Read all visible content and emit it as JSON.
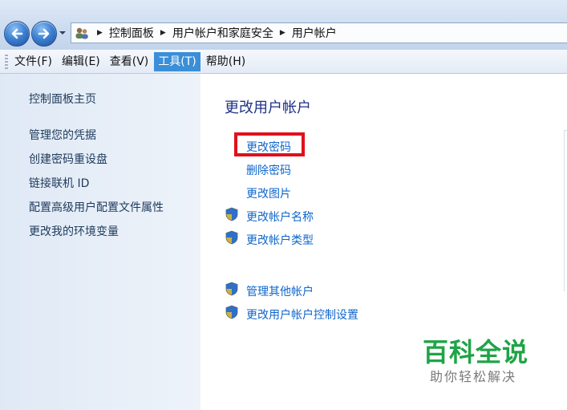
{
  "address_bar": {
    "breadcrumbs": [
      "控制面板",
      "用户帐户和家庭安全",
      "用户帐户"
    ]
  },
  "menu": {
    "items": [
      {
        "label": "文件(F)"
      },
      {
        "label": "编辑(E)"
      },
      {
        "label": "查看(V)"
      },
      {
        "label": "工具(T)",
        "active": true
      },
      {
        "label": "帮助(H)"
      }
    ]
  },
  "sidebar": {
    "home": "控制面板主页",
    "links": [
      "管理您的凭据",
      "创建密码重设盘",
      "链接联机 ID",
      "配置高级用户配置文件属性",
      "更改我的环境变量"
    ]
  },
  "main": {
    "title": "更改用户帐户",
    "tasks": [
      {
        "label": "更改密码",
        "shield": false,
        "highlighted": true
      },
      {
        "label": "删除密码",
        "shield": false
      },
      {
        "label": "更改图片",
        "shield": false
      },
      {
        "label": "更改帐户名称",
        "shield": true
      },
      {
        "label": "更改帐户类型",
        "shield": true
      }
    ],
    "other_tasks": [
      {
        "label": "管理其他帐户",
        "shield": true
      },
      {
        "label": "更改用户帐户控制设置",
        "shield": true
      }
    ]
  },
  "watermark": {
    "title": "百科全说",
    "subtitle": "助你轻松解决"
  },
  "colors": {
    "link": "#0f66cc",
    "title": "#1e3287",
    "highlight_border": "#e0101c",
    "menu_active": "#3a8fd8",
    "watermark_green": "#1fa447"
  }
}
